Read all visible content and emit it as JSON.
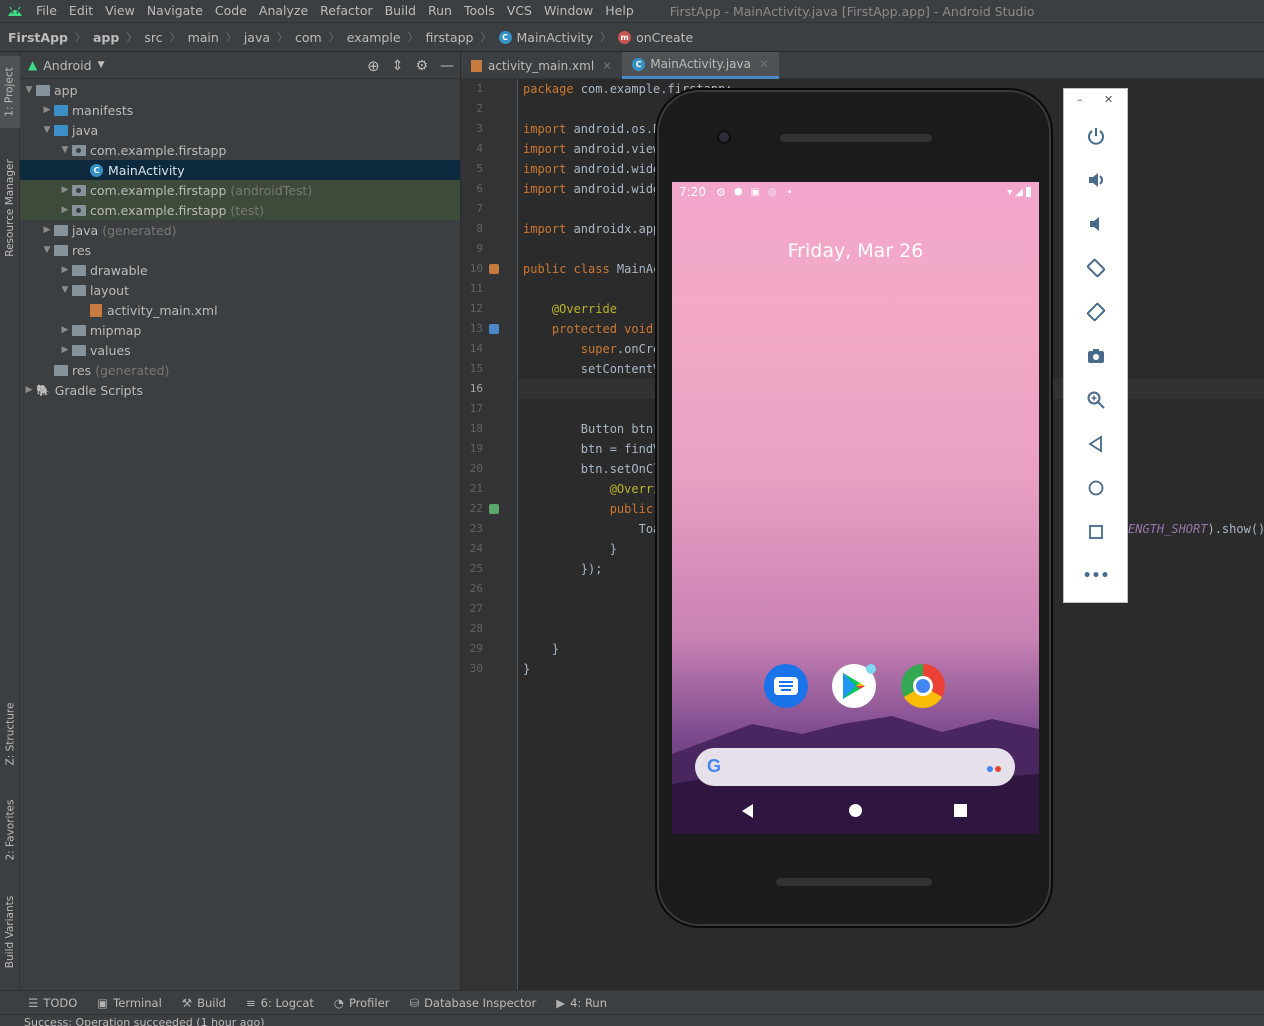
{
  "menubar": {
    "items": [
      "File",
      "Edit",
      "View",
      "Navigate",
      "Code",
      "Analyze",
      "Refactor",
      "Build",
      "Run",
      "Tools",
      "VCS",
      "Window",
      "Help"
    ],
    "window_title": "FirstApp - MainActivity.java [FirstApp.app] - Android Studio"
  },
  "breadcrumb": [
    "FirstApp",
    "app",
    "src",
    "main",
    "java",
    "com",
    "example",
    "firstapp",
    "MainActivity",
    "onCreate"
  ],
  "left_strip": {
    "project": "1: Project",
    "resource_manager": "Resource Manager",
    "structure": "Z: Structure",
    "favorites": "2: Favorites",
    "build_variants": "Build Variants"
  },
  "project_panel": {
    "view_mode": "Android",
    "tree": [
      {
        "label": "app",
        "extra": "",
        "level": 0,
        "arrow": "▼",
        "type": "folder",
        "state": ""
      },
      {
        "label": "manifests",
        "extra": "",
        "level": 1,
        "arrow": "▶",
        "type": "blue",
        "state": ""
      },
      {
        "label": "java",
        "extra": "",
        "level": 1,
        "arrow": "▼",
        "type": "blue",
        "state": ""
      },
      {
        "label": "com.example.firstapp",
        "extra": "",
        "level": 2,
        "arrow": "▼",
        "type": "pkg",
        "state": ""
      },
      {
        "label": "MainActivity",
        "extra": "",
        "level": 3,
        "arrow": "",
        "type": "class",
        "state": "sel"
      },
      {
        "label": "com.example.firstapp",
        "extra": "(androidTest)",
        "level": 2,
        "arrow": "▶",
        "type": "pkg",
        "state": "green"
      },
      {
        "label": "com.example.firstapp",
        "extra": "(test)",
        "level": 2,
        "arrow": "▶",
        "type": "pkg",
        "state": "green"
      },
      {
        "label": "java",
        "extra": "(generated)",
        "level": 1,
        "arrow": "▶",
        "type": "folder",
        "state": ""
      },
      {
        "label": "res",
        "extra": "",
        "level": 1,
        "arrow": "▼",
        "type": "folder",
        "state": ""
      },
      {
        "label": "drawable",
        "extra": "",
        "level": 2,
        "arrow": "▶",
        "type": "folder",
        "state": ""
      },
      {
        "label": "layout",
        "extra": "",
        "level": 2,
        "arrow": "▼",
        "type": "folder",
        "state": ""
      },
      {
        "label": "activity_main.xml",
        "extra": "",
        "level": 3,
        "arrow": "",
        "type": "xml",
        "state": ""
      },
      {
        "label": "mipmap",
        "extra": "",
        "level": 2,
        "arrow": "▶",
        "type": "folder",
        "state": ""
      },
      {
        "label": "values",
        "extra": "",
        "level": 2,
        "arrow": "▶",
        "type": "folder",
        "state": ""
      },
      {
        "label": "res",
        "extra": "(generated)",
        "level": 1,
        "arrow": "",
        "type": "folder",
        "state": ""
      },
      {
        "label": "Gradle Scripts",
        "extra": "",
        "level": 0,
        "arrow": "▶",
        "type": "gradle",
        "state": ""
      }
    ]
  },
  "editor": {
    "tabs": [
      {
        "label": "activity_main.xml",
        "active": false
      },
      {
        "label": "MainActivity.java",
        "active": true
      }
    ],
    "line_numbers": [
      "1",
      "2",
      "3",
      "4",
      "5",
      "6",
      "7",
      "8",
      "9",
      "10",
      "11",
      "12",
      "13",
      "14",
      "15",
      "16",
      "17",
      "18",
      "19",
      "20",
      "21",
      "22",
      "23",
      "24",
      "25",
      "26",
      "27",
      "28",
      "29",
      "30"
    ],
    "current_line": "16",
    "code_lines": [
      {
        "n": 1,
        "parts": [
          [
            "kw",
            "package "
          ],
          [
            "pl",
            "com.example.firstapp;"
          ]
        ]
      },
      {
        "n": 3,
        "parts": [
          [
            "kw",
            "import "
          ],
          [
            "pl",
            "android.os.B"
          ]
        ]
      },
      {
        "n": 4,
        "parts": [
          [
            "kw",
            "import "
          ],
          [
            "pl",
            "android.view"
          ]
        ]
      },
      {
        "n": 5,
        "parts": [
          [
            "kw",
            "import "
          ],
          [
            "pl",
            "android.widg"
          ]
        ]
      },
      {
        "n": 6,
        "parts": [
          [
            "kw",
            "import "
          ],
          [
            "pl",
            "android.widg"
          ]
        ]
      },
      {
        "n": 8,
        "parts": [
          [
            "kw",
            "import "
          ],
          [
            "pl",
            "androidx.app"
          ]
        ]
      },
      {
        "n": 10,
        "parts": [
          [
            "kw",
            "public class "
          ],
          [
            "pl",
            "MainAc"
          ]
        ]
      },
      {
        "n": 12,
        "parts": [
          [
            "an",
            "    @Override"
          ]
        ]
      },
      {
        "n": 13,
        "parts": [
          [
            "kw",
            "    protected void "
          ]
        ]
      },
      {
        "n": 14,
        "parts": [
          [
            "kw",
            "        super"
          ],
          [
            "pl",
            ".onCre"
          ]
        ]
      },
      {
        "n": 15,
        "parts": [
          [
            "pl",
            "        setContentV"
          ]
        ]
      },
      {
        "n": 18,
        "parts": [
          [
            "pl",
            "        Button btn;"
          ]
        ]
      },
      {
        "n": 19,
        "parts": [
          [
            "pl",
            "        btn = findV"
          ]
        ]
      },
      {
        "n": 20,
        "parts": [
          [
            "pl",
            "        btn.setOnCl"
          ]
        ]
      },
      {
        "n": 21,
        "parts": [
          [
            "an",
            "            @Overri"
          ]
        ]
      },
      {
        "n": 22,
        "parts": [
          [
            "kw",
            "            public "
          ]
        ]
      },
      {
        "n": 23,
        "parts": [
          [
            "pl",
            "                Toa"
          ]
        ]
      },
      {
        "n": 24,
        "parts": [
          [
            "pl",
            "            }"
          ]
        ]
      },
      {
        "n": 25,
        "parts": [
          [
            "pl",
            "        });"
          ]
        ]
      },
      {
        "n": 29,
        "parts": [
          [
            "pl",
            "    }"
          ]
        ]
      },
      {
        "n": 30,
        "parts": [
          [
            "pl",
            "}"
          ]
        ]
      }
    ],
    "overflow_text_italic": "ENGTH_SHORT",
    "overflow_text_plain": ").show();"
  },
  "emulator": {
    "time": "7:20",
    "date": "Friday, Mar 26",
    "apps": [
      "messages-icon",
      "play-store-icon",
      "chrome-icon"
    ]
  },
  "bottom_tools": [
    {
      "icon": "☰",
      "label": "TODO"
    },
    {
      "icon": "▣",
      "label": "Terminal"
    },
    {
      "icon": "⚒",
      "label": "Build"
    },
    {
      "icon": "≡",
      "label": "6: Logcat"
    },
    {
      "icon": "◔",
      "label": "Profiler"
    },
    {
      "icon": "⛁",
      "label": "Database Inspector"
    },
    {
      "icon": "▶",
      "label": "4: Run"
    }
  ],
  "status_message": "Success: Operation succeeded (1 hour ago)",
  "colors": {
    "accent": "#4a88c7",
    "keyword": "#cc7832",
    "annotation": "#bbb529",
    "background": "#2b2b2b",
    "panel": "#3c3f41"
  }
}
